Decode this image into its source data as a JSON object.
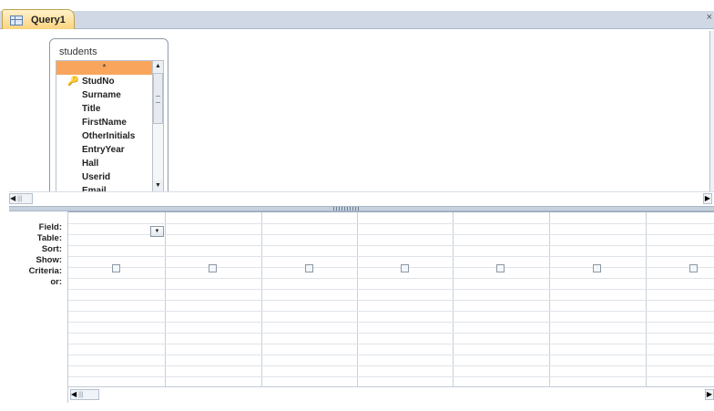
{
  "tab": {
    "title": "Query1",
    "close_symbol": "×"
  },
  "field_list": {
    "title": "students",
    "items": [
      {
        "label": "*"
      },
      {
        "label": "StudNo"
      },
      {
        "label": "Surname"
      },
      {
        "label": "Title"
      },
      {
        "label": "FirstName"
      },
      {
        "label": "OtherInitials"
      },
      {
        "label": "EntryYear"
      },
      {
        "label": "Hall"
      },
      {
        "label": "Userid"
      },
      {
        "label": "Email"
      }
    ]
  },
  "grid": {
    "row_labels": [
      "Field:",
      "Table:",
      "Sort:",
      "Show:",
      "Criteria:",
      "or:"
    ]
  },
  "icons": {
    "key": "🔑",
    "scroll_left": "◀",
    "scroll_right": "▶",
    "scroll_up": "▲",
    "scroll_down": "▼",
    "dropdown": "▼",
    "scroll_mark": "|||"
  }
}
